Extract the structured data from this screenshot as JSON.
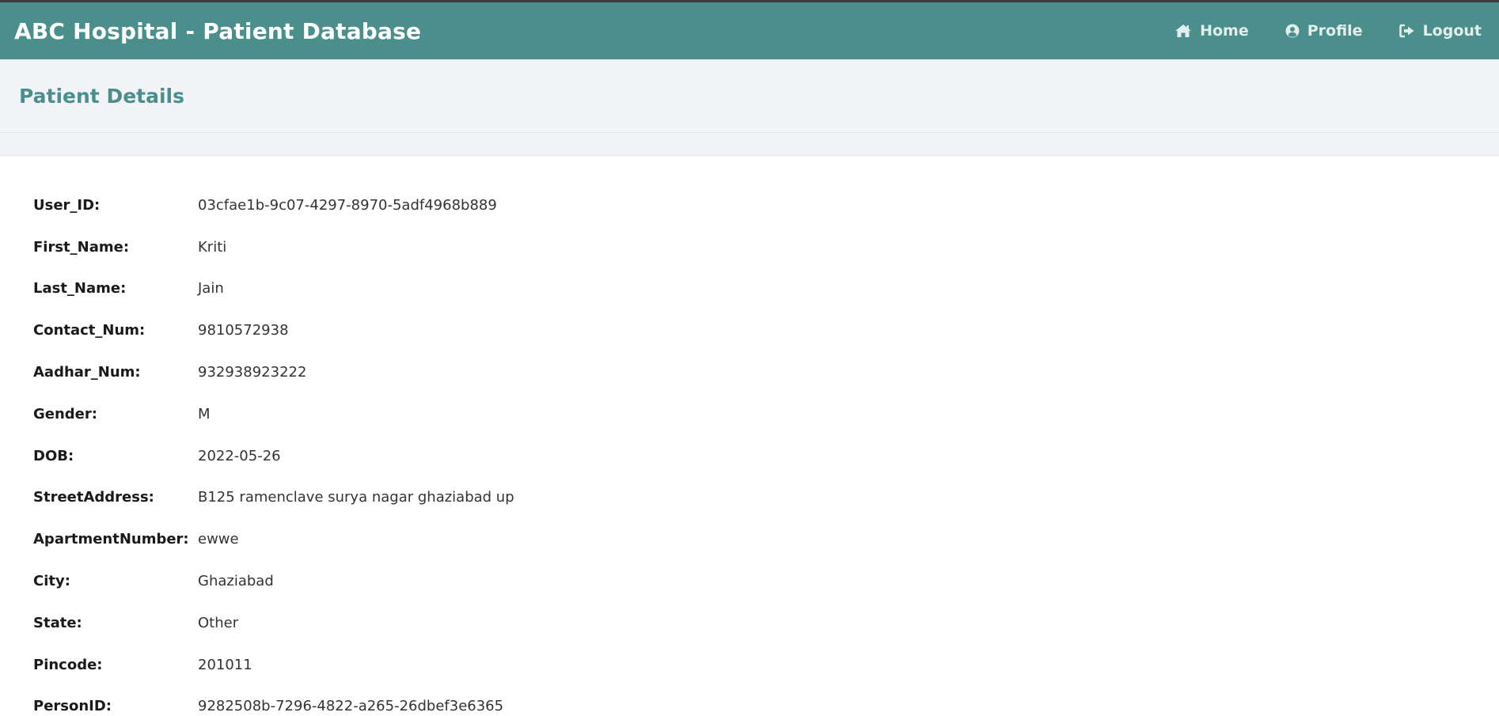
{
  "app": {
    "title": "ABC Hospital - Patient Database",
    "theme_color": "#4a8f8b"
  },
  "nav": {
    "items": [
      {
        "label": "Home",
        "icon": "home-icon"
      },
      {
        "label": "Profile",
        "icon": "user-circle-icon"
      },
      {
        "label": "Logout",
        "icon": "sign-out-icon"
      }
    ]
  },
  "page": {
    "title": "Patient Details"
  },
  "patient": {
    "fields": [
      {
        "label": "User_ID:",
        "value": "03cfae1b-9c07-4297-8970-5adf4968b889"
      },
      {
        "label": "First_Name:",
        "value": "Kriti"
      },
      {
        "label": "Last_Name:",
        "value": "Jain"
      },
      {
        "label": "Contact_Num:",
        "value": "9810572938"
      },
      {
        "label": "Aadhar_Num:",
        "value": "932938923222"
      },
      {
        "label": "Gender:",
        "value": "M"
      },
      {
        "label": "DOB:",
        "value": "2022-05-26"
      },
      {
        "label": "StreetAddress:",
        "value": "B125 ramenclave surya nagar ghaziabad up"
      },
      {
        "label": "ApartmentNumber:",
        "value": "ewwe"
      },
      {
        "label": "City:",
        "value": "Ghaziabad"
      },
      {
        "label": "State:",
        "value": "Other"
      },
      {
        "label": "Pincode:",
        "value": "201011"
      },
      {
        "label": "PersonID:",
        "value": "9282508b-7296-4822-a265-26dbef3e6365"
      }
    ]
  }
}
